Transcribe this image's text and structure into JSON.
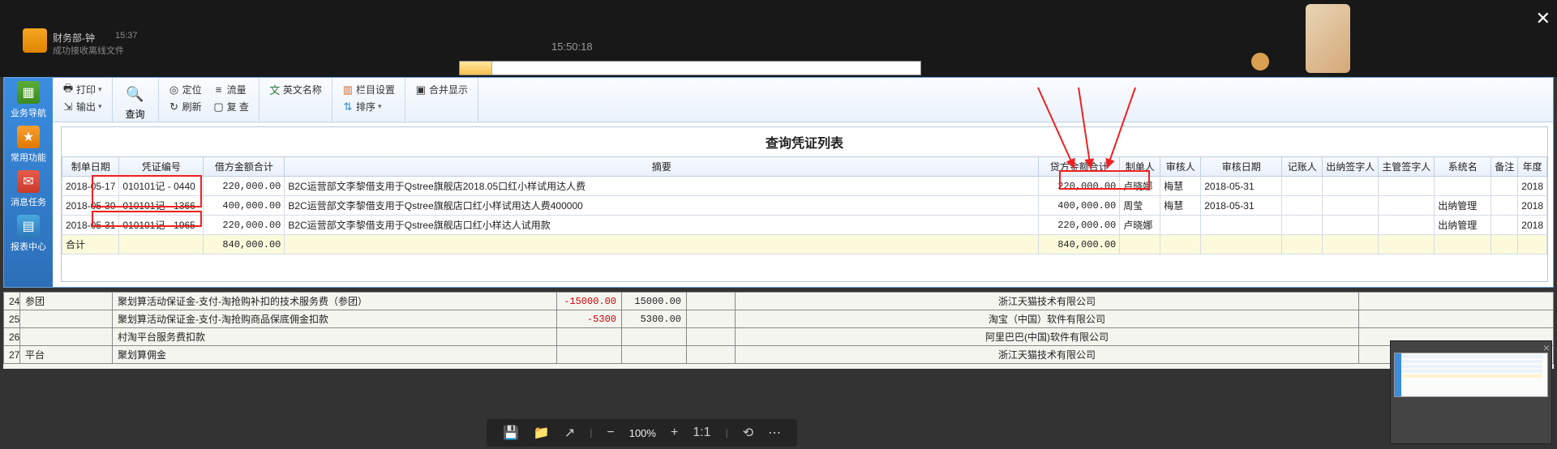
{
  "overlay": {
    "chat_user_dept": "财务部-钟",
    "chat_time": "15:37",
    "chat_sub": "成功接收离线文件",
    "top_time": "15:50:18"
  },
  "sidebar": {
    "items": [
      {
        "label": "业务导航"
      },
      {
        "label": "常用功能"
      },
      {
        "label": "消息任务"
      },
      {
        "label": "报表中心"
      }
    ]
  },
  "toolbar": {
    "print": "打印",
    "output": "输出",
    "query": "查询",
    "locate": "定位",
    "refresh": "刷新",
    "flow": "流量",
    "copy": "复 查",
    "enname": "英文名称",
    "colset": "栏目设置",
    "sort": "排序",
    "merge": "合并显示"
  },
  "table": {
    "title": "查询凭证列表",
    "headers": [
      "制单日期",
      "凭证编号",
      "借方金额合计",
      "摘要",
      "贷方金额合计",
      "制单人",
      "审核人",
      "审核日期",
      "记账人",
      "出纳签字人",
      "主管签字人",
      "系统名",
      "备注",
      "年度"
    ],
    "rows": [
      {
        "date": "2018-05-17",
        "voucher": "010101记 - 0440",
        "debit": "220,000.00",
        "summary": "B2C运营部文李黎借支用于Qstree旗舰店2018.05口红小样试用达人费",
        "credit": "220,000.00",
        "maker": "卢晓娜",
        "auditor": "梅慧",
        "audit_date": "2018-05-31",
        "bookkeeper": "",
        "cashier": "",
        "supervisor": "",
        "sysname": "",
        "remark": "",
        "year": "2018"
      },
      {
        "date": "2018-05-30",
        "voucher": "010101记 - 1366",
        "debit": "400,000.00",
        "summary": "B2C运营部文李黎借支用于Qstree旗舰店口红小样试用达人费400000",
        "credit": "400,000.00",
        "maker": "周莹",
        "auditor": "梅慧",
        "audit_date": "2018-05-31",
        "bookkeeper": "",
        "cashier": "",
        "supervisor": "",
        "sysname": "出纳管理",
        "remark": "",
        "year": "2018"
      },
      {
        "date": "2018-05-31",
        "voucher": "010101记 - 1965",
        "debit": "220,000.00",
        "summary": "B2C运营部文李黎借支用于Qstree旗舰店口红小样达人试用款",
        "credit": "220,000.00",
        "maker": "卢晓娜",
        "auditor": "",
        "audit_date": "",
        "bookkeeper": "",
        "cashier": "",
        "supervisor": "",
        "sysname": "出纳管理",
        "remark": "",
        "year": "2018"
      }
    ],
    "total": {
      "label": "合计",
      "debit": "840,000.00",
      "credit": "840,000.00"
    }
  },
  "bg_grid": {
    "rows": [
      {
        "n": "24",
        "type": "参团",
        "desc": "聚划算活动保证金-支付-淘抢购补扣的技术服务费（参团）",
        "neg": "-15000.00",
        "pos": "15000.00",
        "company": "浙江天猫技术有限公司"
      },
      {
        "n": "25",
        "type": "",
        "desc": "聚划算活动保证金-支付-淘抢购商品保底佣金扣款",
        "neg": "-5300",
        "pos": "5300.00",
        "company": "淘宝（中国）软件有限公司"
      },
      {
        "n": "26",
        "type": "",
        "desc": "村淘平台服务费扣款",
        "neg": "",
        "pos": "",
        "company": "阿里巴巴(中国)软件有限公司"
      },
      {
        "n": "27",
        "type": "平台",
        "desc": "聚划算佣金",
        "neg": "",
        "pos": "",
        "company": "浙江天猫技术有限公司"
      }
    ]
  },
  "viewer": {
    "zoom": "100%"
  }
}
